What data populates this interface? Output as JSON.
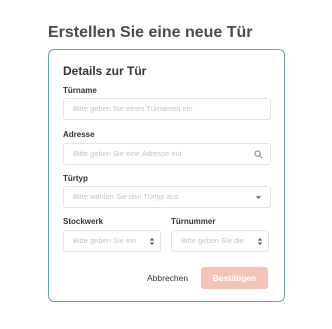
{
  "page": {
    "title": "Erstellen Sie eine neue Tür"
  },
  "card": {
    "title": "Details zur Tür"
  },
  "fields": {
    "door_name": {
      "label": "Türname",
      "placeholder": "Bitte geben Sie einen Türnamen ein"
    },
    "address": {
      "label": "Adresse",
      "placeholder": "Bitte geben Sie eine Adresse ein"
    },
    "door_type": {
      "label": "Türtyp",
      "placeholder": "Bitte wählen Sie den Türtyp aus"
    },
    "floor": {
      "label": "Stockwerk",
      "placeholder": "Bitte geben Sie ein"
    },
    "door_number": {
      "label": "Türnummer",
      "placeholder": "Bitte geben Sie die"
    }
  },
  "actions": {
    "cancel_label": "Abbrechen",
    "confirm_label": "Bestätigen"
  },
  "icons": {
    "address": "search-icon",
    "door_type": "chevron-down-icon",
    "floor": "stepper-icon",
    "door_number": "stepper-icon"
  },
  "colors": {
    "card_border": "#5fa8a6",
    "confirm_button": "#f4c3b7",
    "placeholder_text": "#c0c4cc"
  }
}
